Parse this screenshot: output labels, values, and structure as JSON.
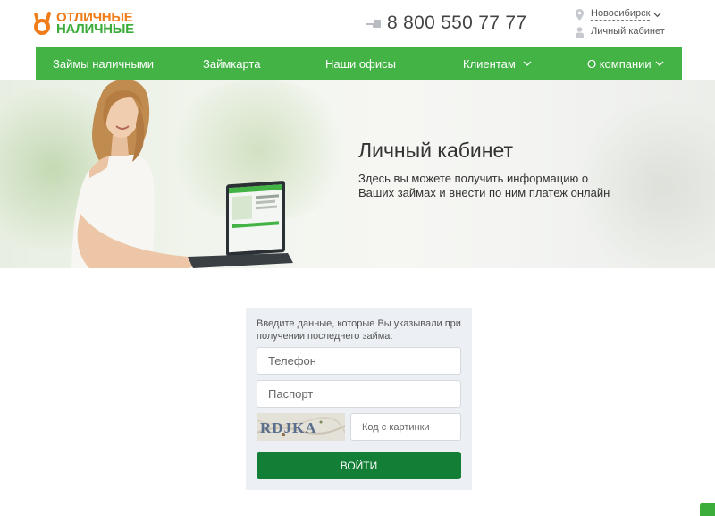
{
  "header": {
    "logo": {
      "line1": "ОТЛИЧНЫЕ",
      "line2": "НАЛИЧНЫЕ"
    },
    "phone": {
      "icon": "hand-pointing-icon",
      "number": "8 800 550 77 77"
    },
    "city": {
      "icon": "location-pin-icon",
      "label": "Новосибирск"
    },
    "cabinet": {
      "icon": "user-icon",
      "label": "Личный кабинет"
    }
  },
  "nav": {
    "items": [
      {
        "label": "Займы наличными",
        "has_dropdown": false
      },
      {
        "label": "Займкарта",
        "has_dropdown": false
      },
      {
        "label": "Наши офисы",
        "has_dropdown": false
      },
      {
        "label": "Клиентам",
        "has_dropdown": true
      },
      {
        "label": "О компании",
        "has_dropdown": true
      }
    ]
  },
  "hero": {
    "title": "Личный кабинет",
    "text": "Здесь вы можете получить информацию о Ваших займах и внести по ним платеж онлайн"
  },
  "login": {
    "hint": "Введите данные, которые Вы указывали при получении последнего займа:",
    "phone_placeholder": "Телефон",
    "passport_placeholder": "Паспорт",
    "captcha_text": "RDJKA",
    "captcha_placeholder": "Код с картинки",
    "submit_label": "ВОЙТИ"
  },
  "colors": {
    "brand_green": "#44b346",
    "button_green": "#137e35",
    "logo_orange": "#f07d1a",
    "form_bg": "#eceff3"
  }
}
